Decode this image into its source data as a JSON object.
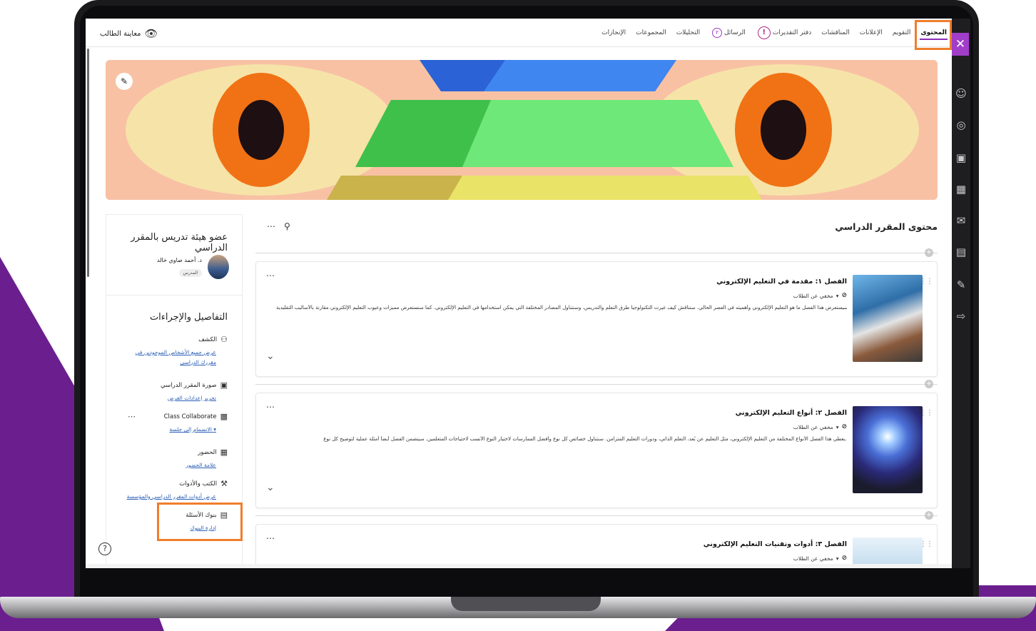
{
  "topbar": {
    "student_view": "معاينة الطالب",
    "tabs": [
      {
        "label": "المحتوى",
        "active": true
      },
      {
        "label": "التقويم"
      },
      {
        "label": "الإعلانات"
      },
      {
        "label": "المناقشات"
      },
      {
        "label": "دفتر التقديرات",
        "badge": "!"
      },
      {
        "label": "الرسائل",
        "badge": "٢"
      },
      {
        "label": "التحليلات"
      },
      {
        "label": "المجموعات"
      },
      {
        "label": "الإنجازات"
      }
    ]
  },
  "course": {
    "content_header": "محتوى المقرر الدراسي",
    "modules": [
      {
        "title": "الفصل ١: مقدمة في التعليم الإلكتروني",
        "visibility": "مخفي عن الطلاب",
        "description": "سيستعرض هذا الفصل ما هو التعليم الإلكتروني وأهميته في العصر الحالي. سنناقش كيف غيرت التكنولوجيا طرق التعلم والتدريس، وسنتناول المصادر المختلفة التي يمكن استخدامها في التعليم الإلكتروني. كما سنستعرض مميزات وعيوب التعليم الإلكتروني مقارنة بالأساليب التقليدية."
      },
      {
        "title": "الفصل ٢: أنواع التعليم الإلكتروني",
        "visibility": "مخفي عن الطلاب",
        "description": "يغطي هذا الفصل الأنواع المختلفة من التعليم الإلكتروني، مثل التعليم عن بُعد، التعلم الذاتي، ودورات التعليم المتزامن. سنتناول خصائص كل نوع وأفضل الممارسات لاختيار النوع الأنسب لاحتياجات المتعلمين. سيتضمن الفصل أيضاً أمثلة عملية لتوضيح كل نوع."
      },
      {
        "title": "الفصل ٣: أدوات وتقنيات التعليم الإلكتروني",
        "visibility": "مخفي عن الطلاب",
        "description": ""
      }
    ]
  },
  "side": {
    "title": "عضو هيئة تدريس بالمقرر الدراسي",
    "instructor_name": "د. أحمد صاوي خالد",
    "instructor_role": "المدرس",
    "details_title": "التفاصيل والإجراءات",
    "details": [
      {
        "icon": "people-search-icon",
        "label": "الكشف",
        "link": "عرض جميع الأشخاص الموجودين في مقررك الدراسي"
      },
      {
        "icon": "image-icon",
        "label": "صورة المقرر الدراسي",
        "link": "تحرير إعدادات العرض"
      },
      {
        "icon": "collaborate-icon",
        "label": "Class Collaborate",
        "link": "الانضمام إلى جلسة"
      },
      {
        "icon": "attendance-icon",
        "label": "الحضور",
        "link": "علامة الحضور"
      },
      {
        "icon": "tools-icon",
        "label": "الكتب والأدوات",
        "link": "عرض أدوات المقرر الدراسي والمؤسسة"
      },
      {
        "icon": "question-bank-icon",
        "label": "بنوك الأسئلة",
        "link": "إدارة البنوك"
      }
    ]
  },
  "colors": {
    "accent": "#8b2fb5",
    "highlight": "#f07d2c",
    "link": "#2b5fb5",
    "brand_purple": "#6b1f8f"
  }
}
